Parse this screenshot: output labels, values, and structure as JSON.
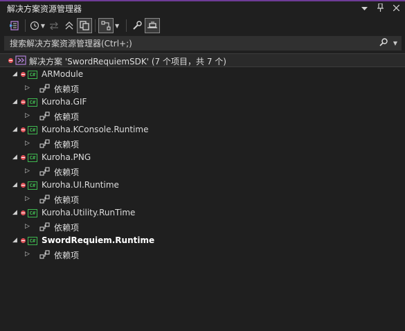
{
  "window": {
    "title": "解决方案资源管理器",
    "controls": [
      "chevron-down-icon",
      "pin-icon",
      "close-icon"
    ]
  },
  "toolbar": {
    "buttons": [
      "solution-switch-icon",
      "history-icon",
      "sync-icon",
      "collapse-all-icon",
      "show-all-files-icon",
      "filter-icon",
      "properties-icon",
      "preview-icon"
    ]
  },
  "search": {
    "placeholder": "搜索解决方案资源管理器(Ctrl+;)"
  },
  "tree": {
    "solution": {
      "label": "解决方案 'SwordRequiemSDK' (7 个项目，共 7 个)"
    },
    "projects": [
      {
        "name": "ARModule",
        "dependencies": "依赖项",
        "bold": false
      },
      {
        "name": "Kuroha.GIF",
        "dependencies": "依赖项",
        "bold": false
      },
      {
        "name": "Kuroha.KConsole.Runtime",
        "dependencies": "依赖项",
        "bold": false
      },
      {
        "name": "Kuroha.PNG",
        "dependencies": "依赖项",
        "bold": false
      },
      {
        "name": "Kuroha.UI.Runtime",
        "dependencies": "依赖项",
        "bold": false
      },
      {
        "name": "Kuroha.Utility.RunTime",
        "dependencies": "依赖项",
        "bold": false
      },
      {
        "name": "SwordRequiem.Runtime",
        "dependencies": "依赖项",
        "bold": true
      }
    ]
  },
  "colors": {
    "background": "#1f1f1f",
    "accent": "#6e3c97",
    "csharp": "#3fb950",
    "error_dot": "#e0545a"
  }
}
